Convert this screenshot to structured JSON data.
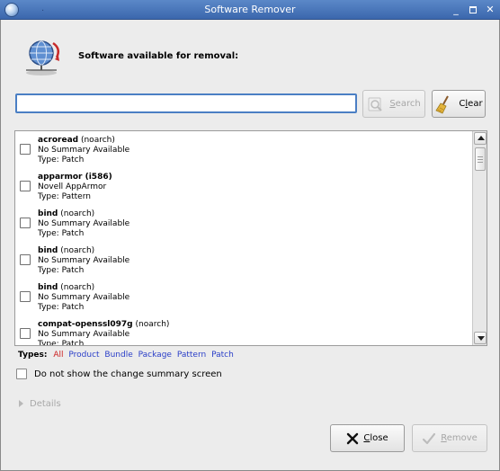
{
  "window": {
    "title": "Software Remover",
    "titlebar_mark": "."
  },
  "header": {
    "label": "Software available for removal:",
    "icon": "globe-network-icon"
  },
  "search": {
    "value": "",
    "placeholder": "",
    "search_label": "Search",
    "search_mnemonic": "S",
    "search_rest": "earch",
    "clear_label": "Clear",
    "clear_pre": "C",
    "clear_mnemonic": "l",
    "clear_rest": "ear"
  },
  "list": {
    "items": [
      {
        "name": "acroread",
        "arch": "(noarch)",
        "summary": "No Summary Available",
        "type": "Type: Patch"
      },
      {
        "name": "apparmor (i586)",
        "arch": "",
        "summary": "Novell AppArmor",
        "type": "Type: Pattern"
      },
      {
        "name": "bind",
        "arch": "(noarch)",
        "summary": "No Summary Available",
        "type": "Type: Patch"
      },
      {
        "name": "bind",
        "arch": "(noarch)",
        "summary": "No Summary Available",
        "type": "Type: Patch"
      },
      {
        "name": "bind",
        "arch": "(noarch)",
        "summary": "No Summary Available",
        "type": "Type: Patch"
      },
      {
        "name": "compat-openssl097g",
        "arch": "(noarch)",
        "summary": "No Summary Available",
        "type": "Type: Patch"
      }
    ]
  },
  "types": {
    "label": "Types:",
    "all": "All",
    "links": [
      "Product",
      "Bundle",
      "Package",
      "Pattern",
      "Patch"
    ]
  },
  "options": {
    "summary_checkbox_label": "Do not show the change summary screen",
    "summary_checked": false
  },
  "details": {
    "label": "Details"
  },
  "footer": {
    "close_label": "Close",
    "close_mnemonic": "C",
    "close_rest": "lose",
    "remove_label": "Remove",
    "remove_mnemonic": "R",
    "remove_rest": "emove"
  },
  "colors": {
    "accent": "#4b7fc4",
    "link": "#2a3ec8",
    "all_link": "#cc2020",
    "titlebar": "#4a78bb"
  }
}
